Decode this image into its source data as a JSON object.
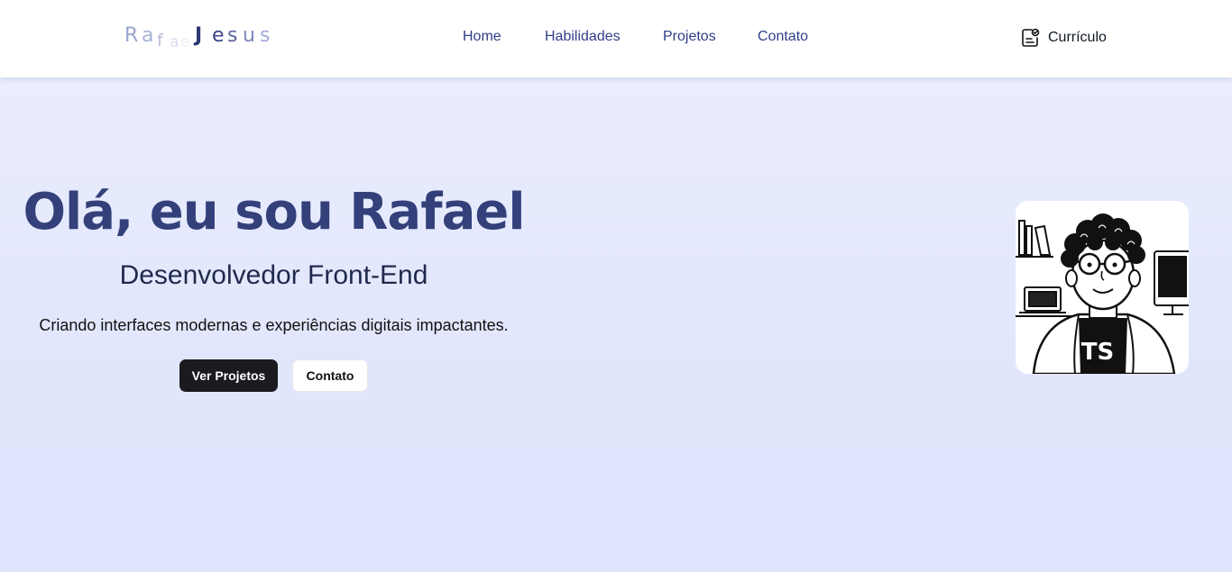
{
  "header": {
    "logo": {
      "first": [
        "R",
        "a",
        "f",
        "a",
        "e"
      ],
      "last": [
        "J",
        "e",
        "s",
        "u",
        "s"
      ]
    },
    "nav": [
      {
        "label": "Home"
      },
      {
        "label": "Habilidades"
      },
      {
        "label": "Projetos"
      },
      {
        "label": "Contato"
      }
    ],
    "resume": {
      "label": "Currículo",
      "icon": "document-check-icon"
    }
  },
  "hero": {
    "title": "Olá, eu sou Rafael",
    "subtitle": "Desenvolvedor Front-End",
    "description": "Criando interfaces modernas e experiências digitais impactantes.",
    "primary_button": "Ver Projetos",
    "secondary_button": "Contato",
    "avatar": {
      "badge_text": "TS"
    }
  },
  "colors": {
    "accent": "#33407a",
    "nav_text": "#2f3f86",
    "primary_button": "#1b1b1f",
    "background": "#e3e7fd"
  }
}
